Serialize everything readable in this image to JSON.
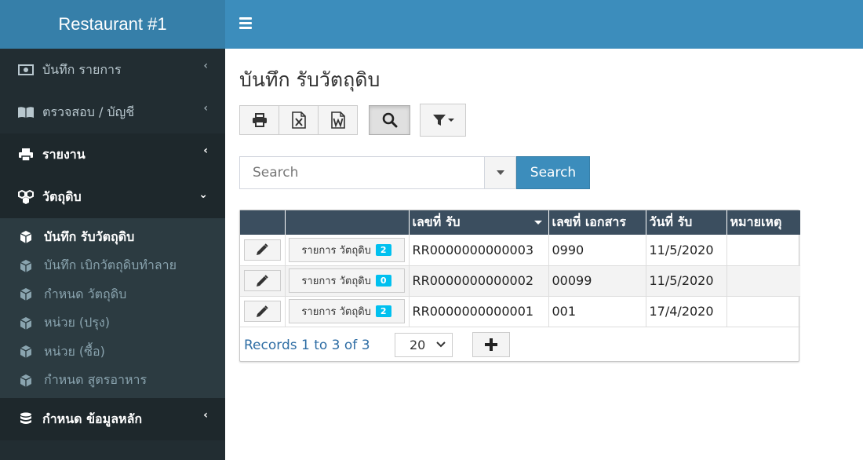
{
  "app": {
    "brand": "Restaurant #1"
  },
  "sidebar": {
    "items": [
      {
        "label": "บันทึก รายการ",
        "icon": "money-icon"
      },
      {
        "label": "ตรวจสอบ / บัญชี",
        "icon": "book-icon"
      },
      {
        "label": "รายงาน",
        "icon": "print-icon"
      },
      {
        "label": "วัตถุดิบ",
        "icon": "cubes-icon"
      },
      {
        "label": "กำหนด ข้อมูลหลัก",
        "icon": "database-icon"
      }
    ],
    "submenu": [
      {
        "label": "บันทึก รับวัตถุดิบ",
        "icon": "cube-icon"
      },
      {
        "label": "บันทึก เบิกวัตถุดิบทำลาย",
        "icon": "cube-icon"
      },
      {
        "label": "กำหนด วัตถุดิบ",
        "icon": "cube-icon"
      },
      {
        "label": "หน่วย (ปรุง)",
        "icon": "cube-icon"
      },
      {
        "label": "หน่วย (ซื้อ)",
        "icon": "cube-icon"
      },
      {
        "label": "กำหนด สูตรอาหาร",
        "icon": "cube-icon"
      }
    ]
  },
  "main": {
    "title": "บันทึก รับวัตถุดิบ",
    "search": {
      "placeholder": "Search",
      "button": "Search"
    },
    "table": {
      "columns": [
        "",
        "",
        "เลขที่ รับ",
        "เลขที่ เอกสาร",
        "วันที่ รับ",
        "หมายเหตุ"
      ],
      "rows": [
        {
          "detail": "รายการ วัตถุดิบ",
          "count": "2",
          "receive_no": "RR0000000000003",
          "doc_no": "0990",
          "date": "11/5/2020",
          "note": ""
        },
        {
          "detail": "รายการ วัตถุดิบ",
          "count": "0",
          "receive_no": "RR0000000000002",
          "doc_no": "00099",
          "date": "11/5/2020",
          "note": ""
        },
        {
          "detail": "รายการ วัตถุดิบ",
          "count": "2",
          "receive_no": "RR0000000000001",
          "doc_no": "001",
          "date": "17/4/2020",
          "note": ""
        }
      ],
      "records_text": "Records 1 to 3 of 3",
      "page_size": "20"
    }
  },
  "colors": {
    "sidebar": "#222d32",
    "brand": "#367fa9",
    "topbar": "#3c8dbc",
    "header": "#3b4e5f",
    "badge": "#00c0ef"
  }
}
